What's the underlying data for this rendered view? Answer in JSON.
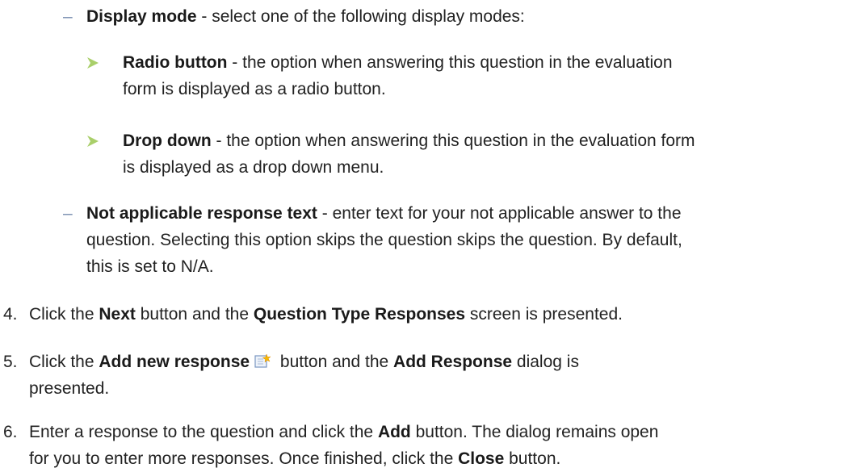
{
  "display_mode": {
    "title": "Display mode",
    "text": " - select one of the following display modes:"
  },
  "radio_button": {
    "title": "Radio button",
    "text_line1": " - the option when answering this question in the evaluation",
    "text_line2": "form is displayed as a radio button."
  },
  "drop_down": {
    "title": "Drop down",
    "text_line1": " - the option when answering this question in the evaluation form",
    "text_line2": "is displayed as a drop down menu."
  },
  "not_applicable": {
    "title": "Not applicable response text",
    "text_line1": " - enter text for your not applicable answer to the",
    "text_line2": "question. Selecting this option skips the question skips the question. By default,",
    "text_line3": "this is set to N/A."
  },
  "step4": {
    "number": "4.",
    "pre": "Click the ",
    "b1": "Next",
    "mid": " button and the ",
    "b2": "Question Type Responses",
    "post": " screen is presented."
  },
  "step5": {
    "number": "5.",
    "pre": "Click the ",
    "b1": "Add new response",
    "mid": " button and the ",
    "b2": "Add Response",
    "post": " dialog is",
    "line2": "presented.",
    "icon": "add-new-response-icon"
  },
  "step6": {
    "number": "6.",
    "pre": "Enter a response to the question and click the ",
    "b1": "Add",
    "post": " button. The dialog remains open",
    "line2_pre": "for you to enter more responses. Once finished, click the ",
    "b2": "Close",
    "line2_post": " button."
  },
  "colors": {
    "arrow_fill": "#a9cf6a",
    "dash": "#7a8fb0"
  }
}
